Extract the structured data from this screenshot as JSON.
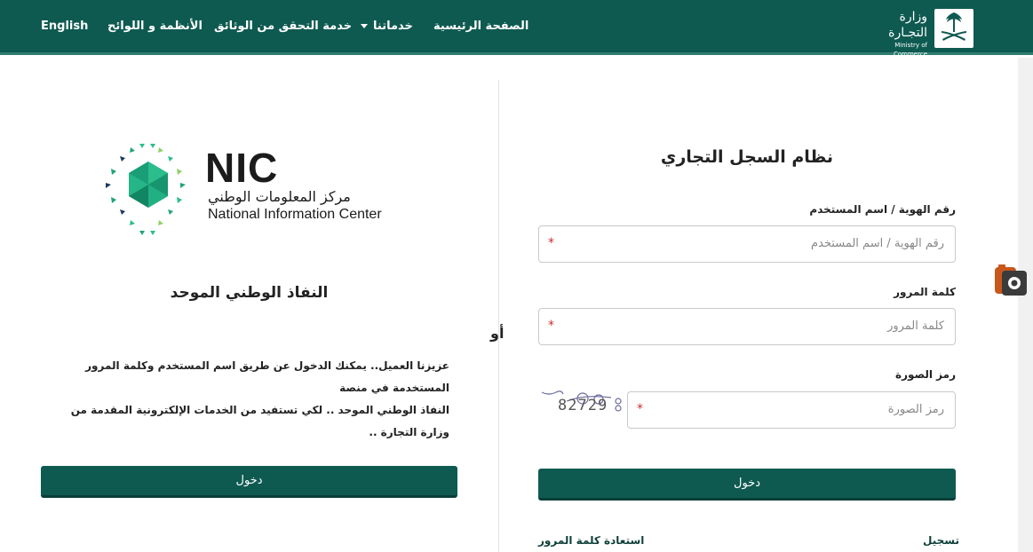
{
  "nav": {
    "english": "English",
    "regulations": "الأنظمة و اللوائح",
    "doc_verification": "خدمة التحقق من الوثائق",
    "services": "خدماتنا",
    "home": "الصفحة الرئيسية"
  },
  "brand": {
    "name_ar": "وزارة التجـارة",
    "name_en": "Ministry of Commerce"
  },
  "right_panel": {
    "title": "نظام السجل التجاري",
    "id_label": "رقم الهوية / اسم المستخدم",
    "id_placeholder": "رقم الهوية / اسم المستخدم",
    "password_label": "كلمة المرور",
    "password_placeholder": "كلمة المرور",
    "captcha_label": "رمز الصورة",
    "captcha_placeholder": "رمز الصورة",
    "captcha_code": "82729",
    "required_mark": "*",
    "login_button": "دخول",
    "register_link": "تسجيل",
    "recover_link": "استعادة كلمة المرور"
  },
  "separator": "أو",
  "left_panel": {
    "nic_word": "NIC",
    "nic_name_ar": "مركز المعلومات الوطني",
    "nic_name_en": "National Information Center",
    "title": "النفاذ الوطني الموحد",
    "description_line1": "عزيزنا العميل.. يمكنك الدخول عن طريق اسم المستخدم وكلمة المرور المستخدمة في منصة",
    "description_line2": "النفاذ الوطني الموحد .. لكي تستفيد من الخدمات الإلكترونية المقدمة من وزارة التجارة ..",
    "login_button": "دخول"
  },
  "colors": {
    "brand": "#0e5a51",
    "nic_green": "#1fa37a",
    "nic_navy": "#1c3a5e",
    "required": "#d12a2a"
  },
  "icons": {
    "services_dropdown": "chevron-down-icon",
    "emblem": "palm-swords-emblem-icon",
    "nic_logo": "nic-hex-logo-icon",
    "side_widget": "camera-badge-icon"
  }
}
